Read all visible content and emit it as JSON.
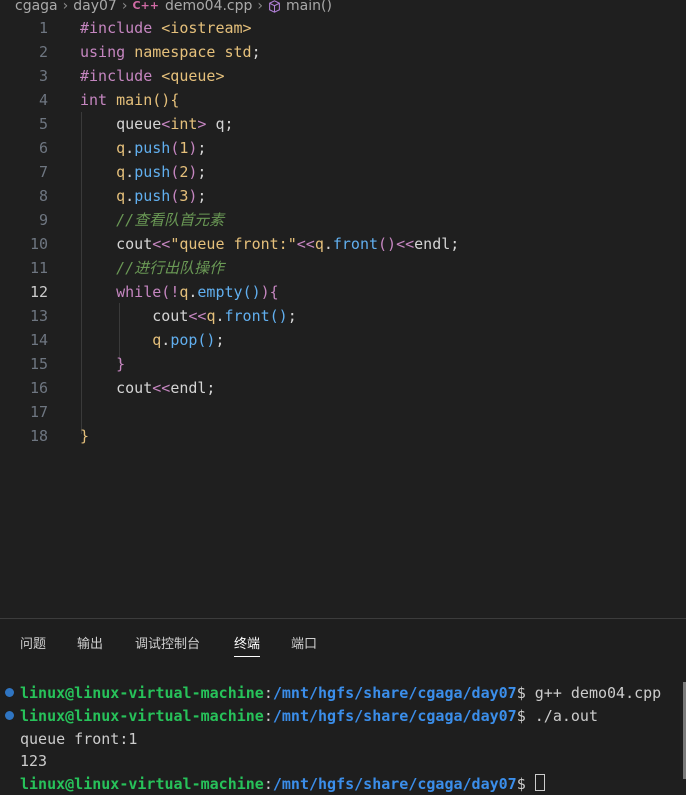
{
  "breadcrumb": {
    "items": [
      "cgaga",
      "day07",
      "demo04.cpp",
      "main()"
    ],
    "file_icon_text": "C++"
  },
  "editor": {
    "active_line": 12,
    "lines": [
      {
        "n": "1",
        "tokens": [
          [
            "kw",
            "#include "
          ],
          [
            "ty",
            "<iostream>"
          ]
        ]
      },
      {
        "n": "2",
        "tokens": [
          [
            "kw",
            "using "
          ],
          [
            "ty",
            "namespace "
          ],
          [
            "ty",
            "std"
          ],
          [
            "plain",
            ";"
          ]
        ]
      },
      {
        "n": "3",
        "tokens": [
          [
            "kw",
            "#include "
          ],
          [
            "ty",
            "<queue>"
          ]
        ]
      },
      {
        "n": "4",
        "tokens": [
          [
            "kw",
            "int "
          ],
          [
            "ty",
            "main"
          ],
          [
            "p1",
            "()"
          ],
          [
            "p1",
            "{"
          ]
        ]
      },
      {
        "n": "5",
        "tokens": [
          [
            "plain",
            "    queue"
          ],
          [
            "op",
            "<"
          ],
          [
            "ty",
            "int"
          ],
          [
            "op",
            ">"
          ],
          [
            "plain",
            " q;"
          ]
        ]
      },
      {
        "n": "6",
        "tokens": [
          [
            "plain",
            "    "
          ],
          [
            "ty",
            "q"
          ],
          [
            "plain",
            "."
          ],
          [
            "fn",
            "push"
          ],
          [
            "p2",
            "("
          ],
          [
            "num",
            "1"
          ],
          [
            "p2",
            ")"
          ],
          [
            "plain",
            ";"
          ]
        ]
      },
      {
        "n": "7",
        "tokens": [
          [
            "plain",
            "    "
          ],
          [
            "ty",
            "q"
          ],
          [
            "plain",
            "."
          ],
          [
            "fn",
            "push"
          ],
          [
            "p2",
            "("
          ],
          [
            "num",
            "2"
          ],
          [
            "p2",
            ")"
          ],
          [
            "plain",
            ";"
          ]
        ]
      },
      {
        "n": "8",
        "tokens": [
          [
            "plain",
            "    "
          ],
          [
            "ty",
            "q"
          ],
          [
            "plain",
            "."
          ],
          [
            "fn",
            "push"
          ],
          [
            "p2",
            "("
          ],
          [
            "num",
            "3"
          ],
          [
            "p2",
            ")"
          ],
          [
            "plain",
            ";"
          ]
        ]
      },
      {
        "n": "9",
        "tokens": [
          [
            "plain",
            "    "
          ],
          [
            "cm",
            "//查看队首元素"
          ]
        ]
      },
      {
        "n": "10",
        "tokens": [
          [
            "plain",
            "    cout"
          ],
          [
            "op",
            "<<"
          ],
          [
            "str",
            "\"queue front:\""
          ],
          [
            "op",
            "<<"
          ],
          [
            "ty",
            "q"
          ],
          [
            "plain",
            "."
          ],
          [
            "fn",
            "front"
          ],
          [
            "p2",
            "()"
          ],
          [
            "op",
            "<<"
          ],
          [
            "plain",
            "endl;"
          ]
        ]
      },
      {
        "n": "11",
        "tokens": [
          [
            "plain",
            "    "
          ],
          [
            "cm",
            "//进行出队操作"
          ]
        ]
      },
      {
        "n": "12",
        "tokens": [
          [
            "plain",
            "    "
          ],
          [
            "kw",
            "while"
          ],
          [
            "p2",
            "("
          ],
          [
            "op",
            "!"
          ],
          [
            "ty",
            "q"
          ],
          [
            "plain",
            "."
          ],
          [
            "fn",
            "empty"
          ],
          [
            "fn",
            "()"
          ],
          [
            "p2",
            ")"
          ],
          [
            "p2",
            "{"
          ]
        ]
      },
      {
        "n": "13",
        "tokens": [
          [
            "plain",
            "        cout"
          ],
          [
            "op",
            "<<"
          ],
          [
            "ty",
            "q"
          ],
          [
            "plain",
            "."
          ],
          [
            "fn",
            "front"
          ],
          [
            "fn",
            "()"
          ],
          [
            "plain",
            ";"
          ]
        ]
      },
      {
        "n": "14",
        "tokens": [
          [
            "plain",
            "        "
          ],
          [
            "ty",
            "q"
          ],
          [
            "plain",
            "."
          ],
          [
            "fn",
            "pop"
          ],
          [
            "fn",
            "()"
          ],
          [
            "plain",
            ";"
          ]
        ]
      },
      {
        "n": "15",
        "tokens": [
          [
            "plain",
            "    "
          ],
          [
            "p2",
            "}"
          ]
        ]
      },
      {
        "n": "16",
        "tokens": [
          [
            "plain",
            "    cout"
          ],
          [
            "op",
            "<<"
          ],
          [
            "plain",
            "endl;"
          ]
        ]
      },
      {
        "n": "17",
        "tokens": []
      },
      {
        "n": "18",
        "tokens": [
          [
            "p1",
            "}"
          ]
        ]
      }
    ]
  },
  "panel": {
    "tabs": [
      "问题",
      "输出",
      "调试控制台",
      "终端",
      "端口"
    ],
    "active_tab": "终端"
  },
  "terminal": {
    "lines": [
      {
        "dot": true,
        "user": "linux@linux-virtual-machine",
        "sep": ":",
        "path": "/mnt/hgfs/share/cgaga/day07",
        "prompt": "$ ",
        "cmd": "g++ demo04.cpp"
      },
      {
        "dot": true,
        "user": "linux@linux-virtual-machine",
        "sep": ":",
        "path": "/mnt/hgfs/share/cgaga/day07",
        "prompt": "$ ",
        "cmd": "./a.out"
      },
      {
        "dot": false,
        "text": "queue front:1"
      },
      {
        "dot": false,
        "text": "123"
      },
      {
        "dot": false,
        "user": "linux@linux-virtual-machine",
        "sep": ":",
        "path": "/mnt/hgfs/share/cgaga/day07",
        "prompt": "$ ",
        "cmd": "",
        "cursor": true
      }
    ]
  },
  "colors": {
    "background": "#1f1f1f",
    "keyword": "#c586c0",
    "type": "#e5c07b",
    "function": "#61afef",
    "comment": "#6a9955",
    "terminal_user": "#27c25a",
    "terminal_path": "#3b8eea"
  }
}
